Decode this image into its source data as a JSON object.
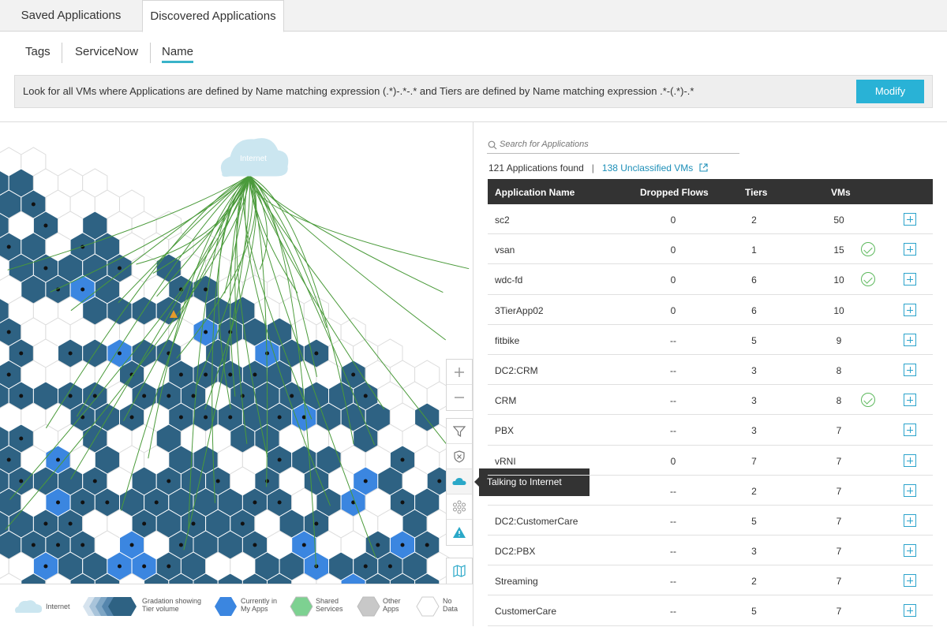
{
  "top_tabs": [
    "Saved Applications",
    "Discovered Applications"
  ],
  "sub_tabs": [
    "Tags",
    "ServiceNow",
    "Name"
  ],
  "filter": {
    "text": "Look for all VMs where Applications are defined by Name matching expression (.*)-.*-.* and Tiers are defined by Name matching expression .*-(.*)-.*",
    "modify_label": "Modify"
  },
  "graph": {
    "internet_label": "Internet",
    "tooltip": "Talking to Internet",
    "colors": {
      "dark_node": "#2e6283",
      "my_app_node": "#3b86e0",
      "flow_line": "#4a9a3a",
      "internet": "#cbe6f0"
    }
  },
  "legend": {
    "internet": "Internet",
    "gradation": "Gradation showing\nTier volume",
    "my_apps": "Currently in\nMy Apps",
    "shared": "Shared\nServices",
    "other": "Other\nApps",
    "no_data": "No\nData"
  },
  "search": {
    "placeholder": "Search for Applications"
  },
  "summary": {
    "found": "121 Applications found",
    "sep": "|",
    "unclassified": "138 Unclassified VMs"
  },
  "table": {
    "headers": {
      "name": "Application Name",
      "dropped": "Dropped Flows",
      "tiers": "Tiers",
      "vms": "VMs"
    },
    "rows": [
      {
        "name": "sc2",
        "dropped": "0",
        "tiers": "2",
        "vms": "50",
        "check": false
      },
      {
        "name": "vsan",
        "dropped": "0",
        "tiers": "1",
        "vms": "15",
        "check": true
      },
      {
        "name": "wdc-fd",
        "dropped": "0",
        "tiers": "6",
        "vms": "10",
        "check": true
      },
      {
        "name": "3TierApp02",
        "dropped": "0",
        "tiers": "6",
        "vms": "10",
        "check": false
      },
      {
        "name": "fitbike",
        "dropped": "--",
        "tiers": "5",
        "vms": "9",
        "check": false
      },
      {
        "name": "DC2:CRM",
        "dropped": "--",
        "tiers": "3",
        "vms": "8",
        "check": false
      },
      {
        "name": "CRM",
        "dropped": "--",
        "tiers": "3",
        "vms": "8",
        "check": true
      },
      {
        "name": "PBX",
        "dropped": "--",
        "tiers": "3",
        "vms": "7",
        "check": false
      },
      {
        "name": "vRNI",
        "dropped": "0",
        "tiers": "7",
        "vms": "7",
        "check": false
      },
      {
        "name": "",
        "dropped": "--",
        "tiers": "2",
        "vms": "7",
        "check": false
      },
      {
        "name": "DC2:CustomerCare",
        "dropped": "--",
        "tiers": "5",
        "vms": "7",
        "check": false
      },
      {
        "name": "DC2:PBX",
        "dropped": "--",
        "tiers": "3",
        "vms": "7",
        "check": false
      },
      {
        "name": "Streaming",
        "dropped": "--",
        "tiers": "2",
        "vms": "7",
        "check": false
      },
      {
        "name": "CustomerCare",
        "dropped": "--",
        "tiers": "5",
        "vms": "7",
        "check": false
      }
    ]
  }
}
